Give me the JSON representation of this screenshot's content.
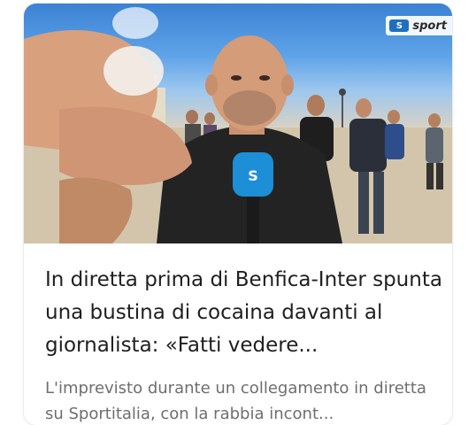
{
  "article": {
    "logo_mark": "S",
    "logo_text": "sport",
    "headline": "In diretta prima di Benfica-Inter spunta una bustina di cocaina davanti al giornalista: «Fatti vedere...",
    "summary": "L'imprevisto durante un collegamento in diretta su Sportitalia, con la rabbia incont..."
  },
  "colors": {
    "headline_text": "#1f1f1f",
    "summary_text": "#6e6e6e",
    "mic_blue": "#1c8fd6",
    "card_background": "#ffffff"
  }
}
